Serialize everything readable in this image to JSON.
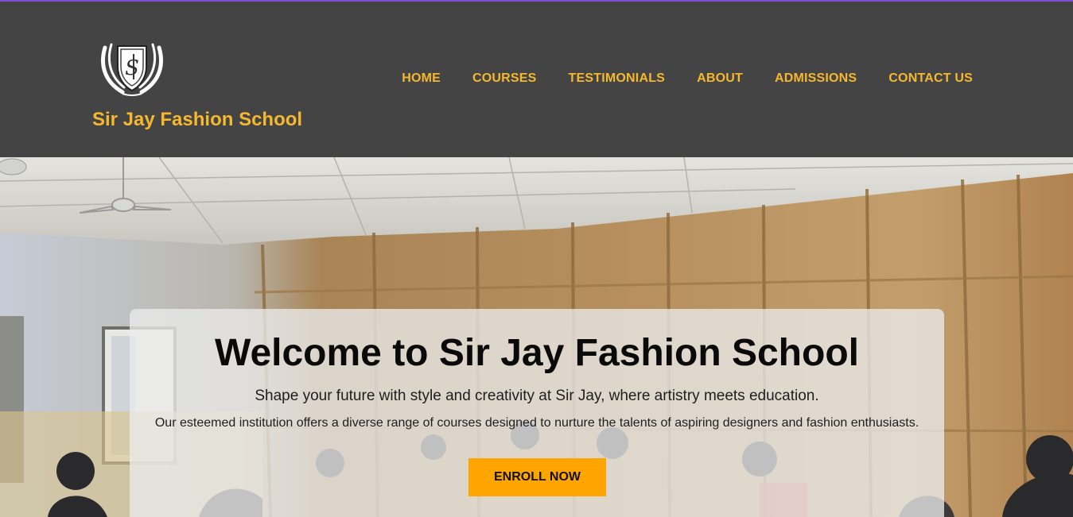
{
  "header": {
    "brand": "Sir Jay Fashion School",
    "logo_icon": "shield-crest-icon"
  },
  "nav": {
    "items": [
      {
        "label": "HOME"
      },
      {
        "label": "COURSES"
      },
      {
        "label": "TESTIMONIALS"
      },
      {
        "label": "ABOUT"
      },
      {
        "label": "ADMISSIONS"
      },
      {
        "label": "CONTACT US"
      }
    ]
  },
  "hero": {
    "title": "Welcome to Sir Jay Fashion School",
    "subtitle": "Shape your future with style and creativity at Sir Jay, where artistry meets education.",
    "description": "Our esteemed institution offers a diverse range of courses designed to nurture the talents of aspiring designers and fashion enthusiasts.",
    "cta_label": "ENROLL NOW"
  },
  "colors": {
    "header_bg": "#444444",
    "accent": "#f5b82e",
    "cta": "#ffa500",
    "top_border": "#7b4fd6"
  }
}
